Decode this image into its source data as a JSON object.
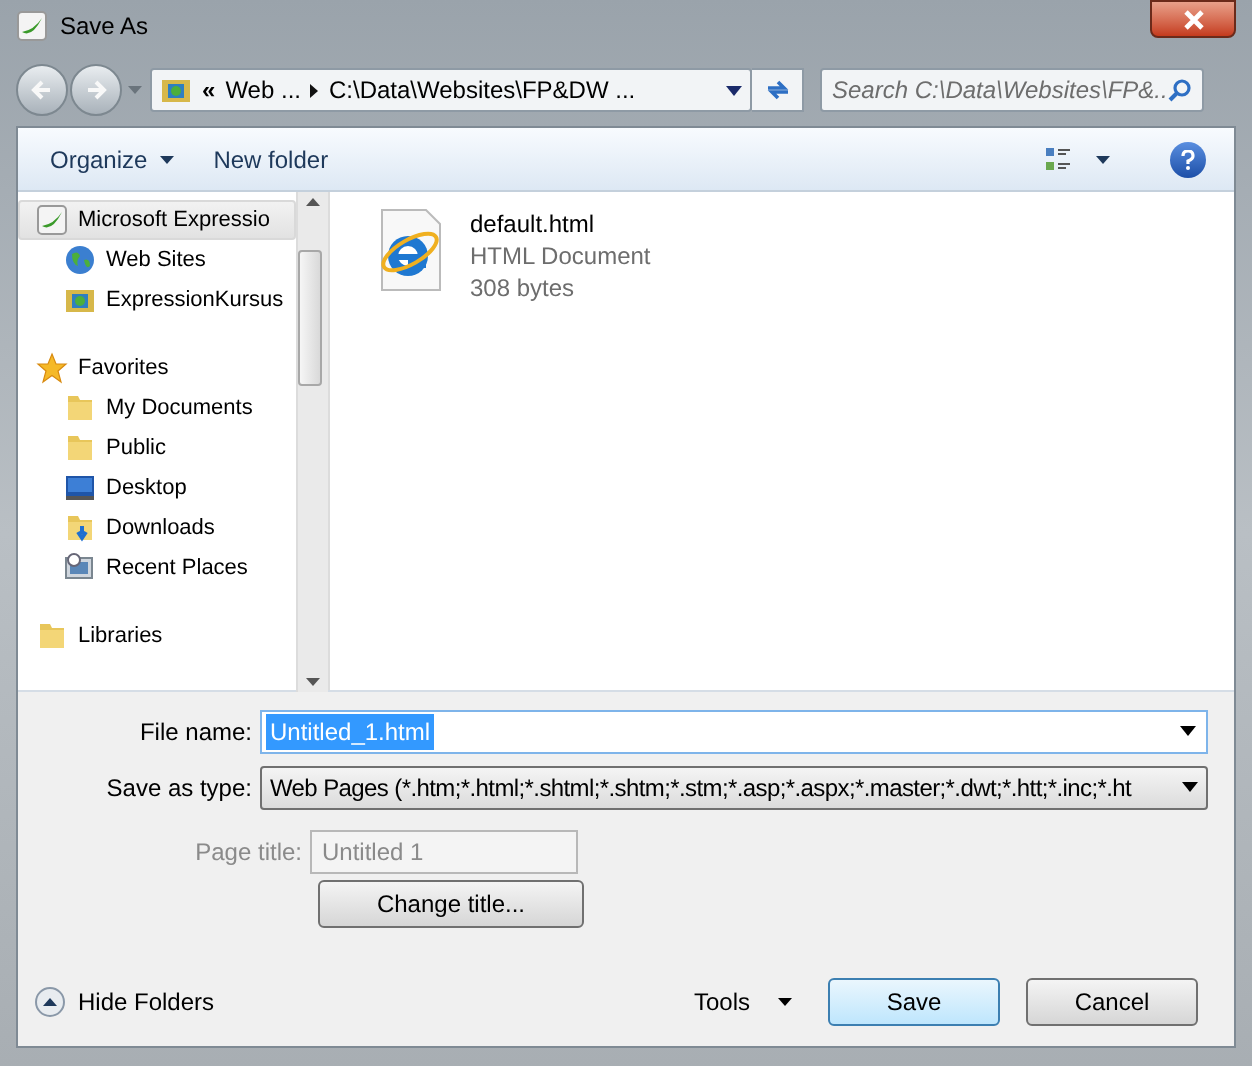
{
  "window": {
    "title": "Save As"
  },
  "address": {
    "segments": [
      "«",
      "Web ...",
      "C:\\Data\\Websites\\FP&DW ..."
    ]
  },
  "search": {
    "placeholder": "Search C:\\Data\\Websites\\FP&..."
  },
  "toolbar": {
    "organize": "Organize",
    "new_folder": "New folder"
  },
  "sidebar": {
    "items": [
      {
        "label": "Microsoft Expressio",
        "kind": "expression",
        "selected": true,
        "children": [
          {
            "label": "Web Sites",
            "kind": "globe",
            "selected": false
          },
          {
            "label": "ExpressionKursus",
            "kind": "site",
            "selected": false
          }
        ]
      },
      {
        "label": "Favorites",
        "kind": "star",
        "selected": false,
        "children": [
          {
            "label": "My Documents",
            "kind": "folder",
            "selected": false
          },
          {
            "label": "Public",
            "kind": "folder",
            "selected": false
          },
          {
            "label": "Desktop",
            "kind": "desktop",
            "selected": false
          },
          {
            "label": "Downloads",
            "kind": "download",
            "selected": false
          },
          {
            "label": "Recent Places",
            "kind": "recent",
            "selected": false
          }
        ]
      },
      {
        "label": "Libraries",
        "kind": "folder",
        "selected": false
      }
    ]
  },
  "files": [
    {
      "name": "default.html",
      "type": "HTML Document",
      "size": "308 bytes"
    }
  ],
  "form": {
    "file_name_label": "File name:",
    "file_name": "Untitled_1.html",
    "type_label": "Save as type:",
    "type": "Web Pages (*.htm;*.html;*.shtml;*.shtm;*.stm;*.asp;*.aspx;*.master;*.dwt;*.htt;*.inc;*.ht",
    "page_title_label": "Page title:",
    "page_title": "Untitled 1",
    "change_title": "Change title..."
  },
  "footer": {
    "hide_folders": "Hide Folders",
    "tools": "Tools",
    "save": "Save",
    "cancel": "Cancel"
  }
}
